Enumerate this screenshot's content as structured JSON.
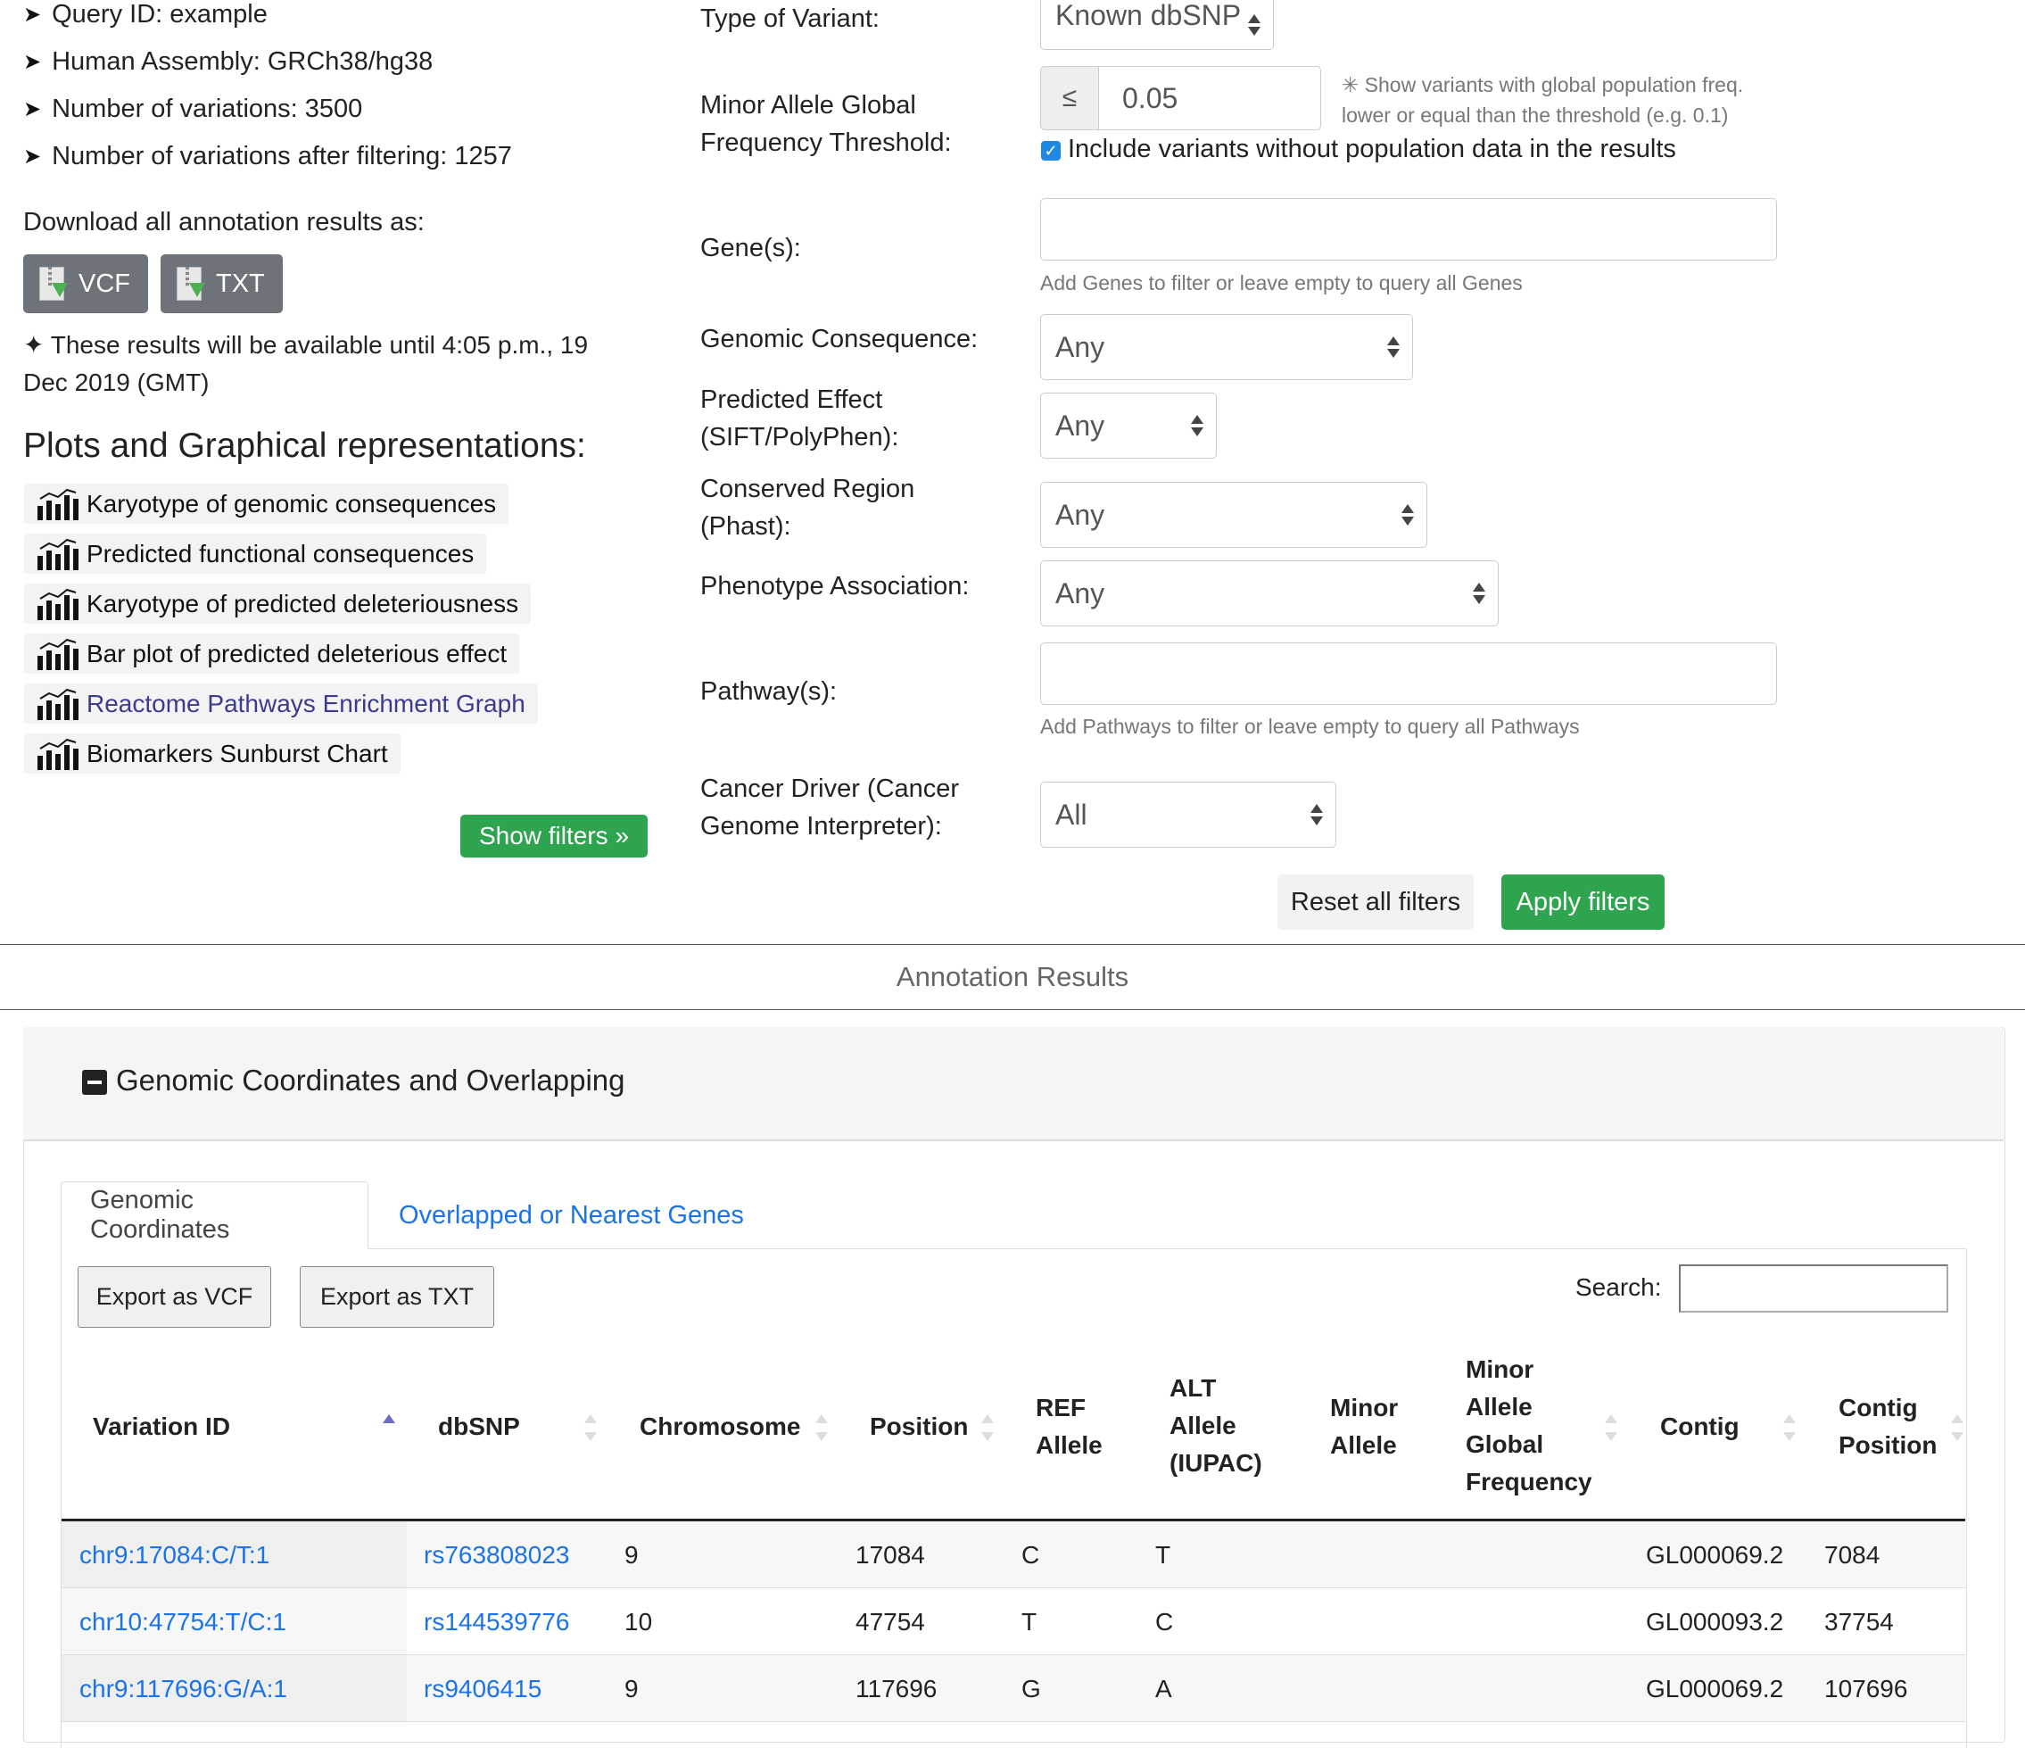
{
  "summary": {
    "query_id": "Query ID: example",
    "assembly": "Human Assembly: GRCh38/hg38",
    "variations": "Number of variations: 3500",
    "variations_filtered": "Number of variations after filtering: 1257",
    "download_label": "Download all annotation results as:",
    "vcf_label": "VCF",
    "txt_label": "TXT",
    "availability_line1": "✦ These results will be available until 4:05 p.m., 19",
    "availability_line2": "Dec 2019 (GMT)"
  },
  "plots": {
    "title": "Plots and Graphical representations:",
    "items": [
      {
        "label": "Karyotype of genomic consequences"
      },
      {
        "label": "Predicted functional consequences"
      },
      {
        "label": "Karyotype of predicted deleteriousness"
      },
      {
        "label": "Bar plot of predicted deleterious effect"
      },
      {
        "label": "Reactome Pathways Enrichment Graph"
      },
      {
        "label": "Biomarkers Sunburst Chart"
      }
    ],
    "show_filters": "Show filters »"
  },
  "filters": {
    "type_of_variant": {
      "label": "Type of Variant:",
      "value": "Known dbSNP"
    },
    "maf": {
      "label1": "Minor Allele Global",
      "label2": "Frequency Threshold:",
      "operator": "≤",
      "value": "0.05",
      "note1": "✳ Show variants with global population freq.",
      "note2": "lower or equal than the threshold (e.g. 0.1)",
      "include_label": "Include variants without population data in the results"
    },
    "genes": {
      "label": "Gene(s):",
      "help": "Add Genes to filter or leave empty to query all Genes",
      "value": ""
    },
    "consequence": {
      "label": "Genomic Consequence:",
      "value": "Any"
    },
    "predicted_effect": {
      "label1": "Predicted Effect",
      "label2": "(SIFT/PolyPhen):",
      "value": "Any"
    },
    "conserved": {
      "label1": "Conserved Region",
      "label2": "(Phast):",
      "value": "Any"
    },
    "phenotype": {
      "label": "Phenotype Association:",
      "value": "Any"
    },
    "pathways": {
      "label": "Pathway(s):",
      "help": "Add Pathways to filter or leave empty to query all Pathways",
      "value": ""
    },
    "cancer_driver": {
      "label1": "Cancer Driver (Cancer",
      "label2": "Genome Interpreter):",
      "value": "All"
    },
    "reset": "Reset all filters",
    "apply": "Apply filters"
  },
  "results": {
    "bar_title": "Annotation Results",
    "panel_title": "Genomic Coordinates and Overlapping",
    "tabs": [
      {
        "label": "Genomic Coordinates"
      },
      {
        "label": "Overlapped or Nearest Genes"
      }
    ],
    "export_vcf": "Export as VCF",
    "export_txt": "Export as TXT",
    "search_label": "Search:",
    "columns": {
      "variation_id": "Variation ID",
      "dbsnp": "dbSNP",
      "chromosome": "Chromosome",
      "position": "Position",
      "ref1": "REF",
      "ref2": "Allele",
      "alt1": "ALT",
      "alt2": "Allele",
      "alt3": "(IUPAC)",
      "minor1": "Minor",
      "minor2": "Allele",
      "maf1": "Minor",
      "maf2": "Allele",
      "maf3": "Global",
      "maf4": "Frequency",
      "contig": "Contig",
      "contigpos1": "Contig",
      "contigpos2": "Position"
    },
    "rows": [
      {
        "id": "chr9:17084:C/T:1",
        "dbsnp": "rs763808023",
        "chrom": "9",
        "pos": "17084",
        "ref": "C",
        "alt": "T",
        "minor": "",
        "maf": "",
        "contig": "GL000069.2",
        "contig_pos": "7084"
      },
      {
        "id": "chr10:47754:T/C:1",
        "dbsnp": "rs144539776",
        "chrom": "10",
        "pos": "47754",
        "ref": "T",
        "alt": "C",
        "minor": "",
        "maf": "",
        "contig": "GL000093.2",
        "contig_pos": "37754"
      },
      {
        "id": "chr9:117696:G/A:1",
        "dbsnp": "rs9406415",
        "chrom": "9",
        "pos": "117696",
        "ref": "G",
        "alt": "A",
        "minor": "",
        "maf": "",
        "contig": "GL000069.2",
        "contig_pos": "107696"
      }
    ]
  },
  "colors": {
    "green": "#2ea44f",
    "link": "#1a73e8",
    "gray_button": "#6d7378",
    "checkbox": "#1e88e5"
  }
}
